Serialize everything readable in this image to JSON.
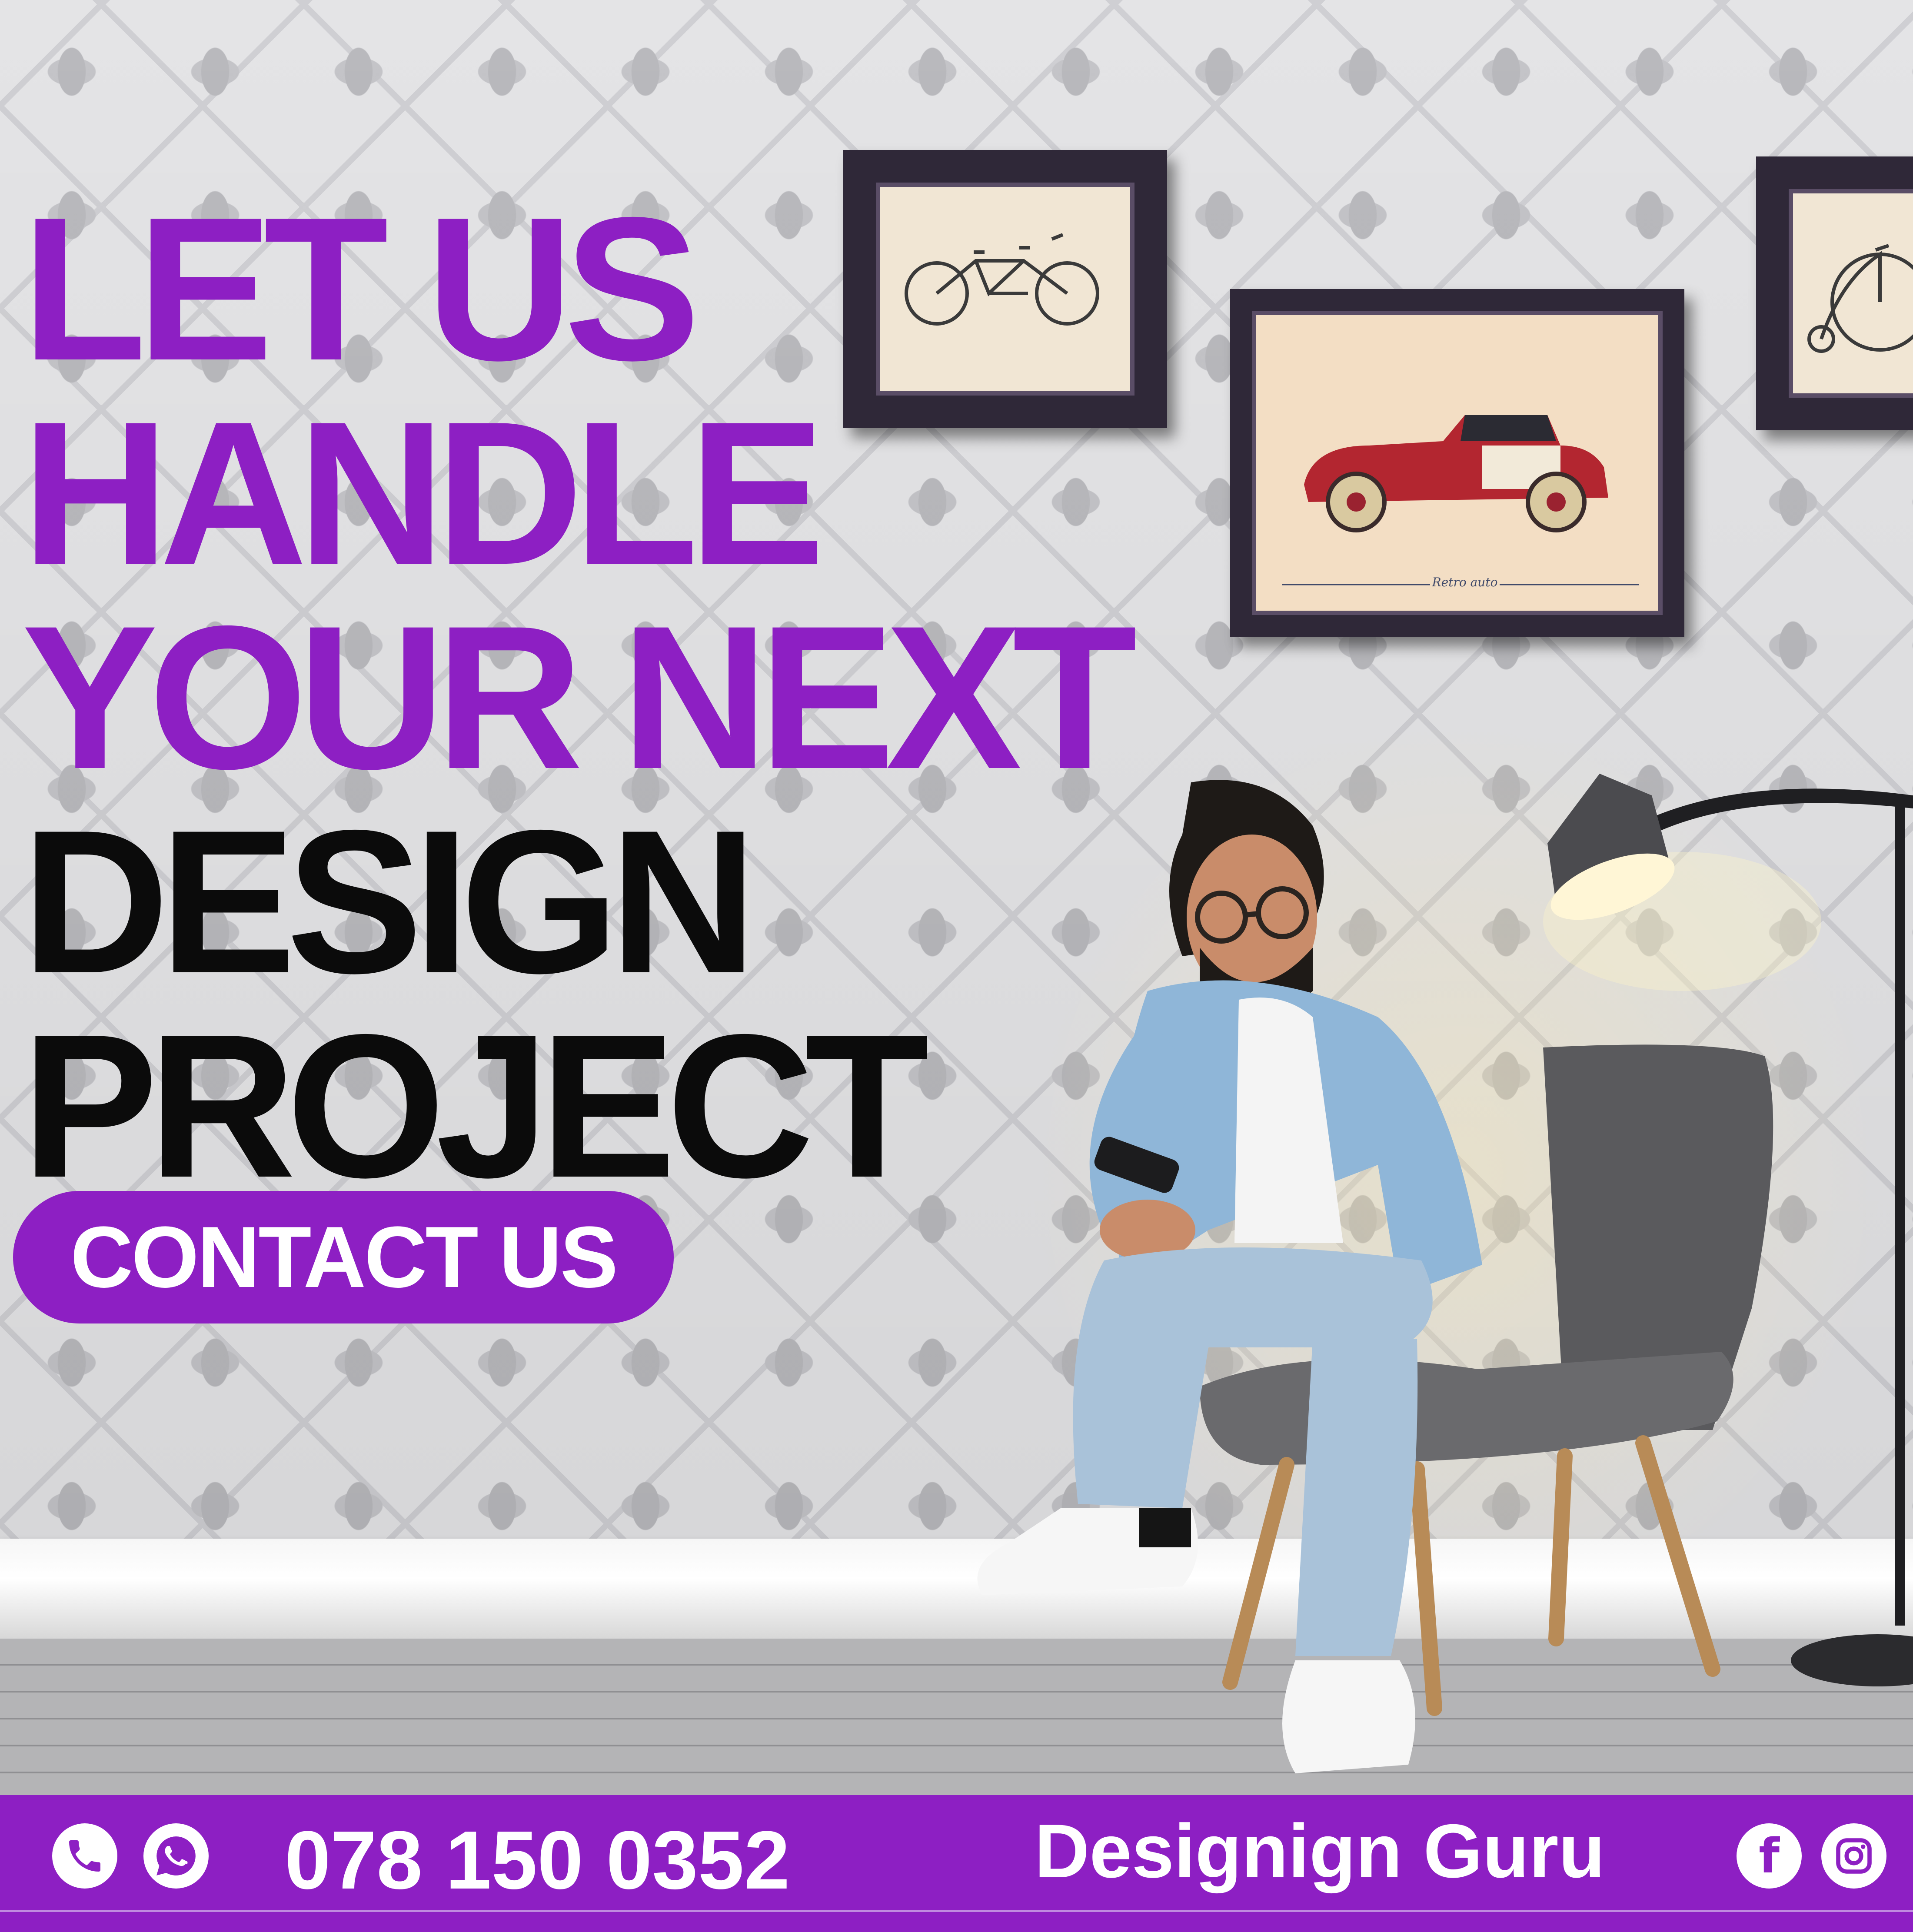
{
  "headline": {
    "line1": "LET US",
    "line2": "HANDLE",
    "line3": "YOUR NEXT",
    "line4": "DESIGN",
    "line5": "PROJECT"
  },
  "cta": {
    "label": "CONTACT US"
  },
  "poster_caption": "Retro auto",
  "footer": {
    "phone": "078 150 0352",
    "brand": "Designign Guru"
  },
  "icons": [
    "phone-icon",
    "whatsapp-icon",
    "facebook-icon",
    "instagram-icon"
  ],
  "colors": {
    "accent": "#8d1fc3",
    "headline_dark": "#0b0b0b",
    "text_on_accent": "#ffffff"
  }
}
